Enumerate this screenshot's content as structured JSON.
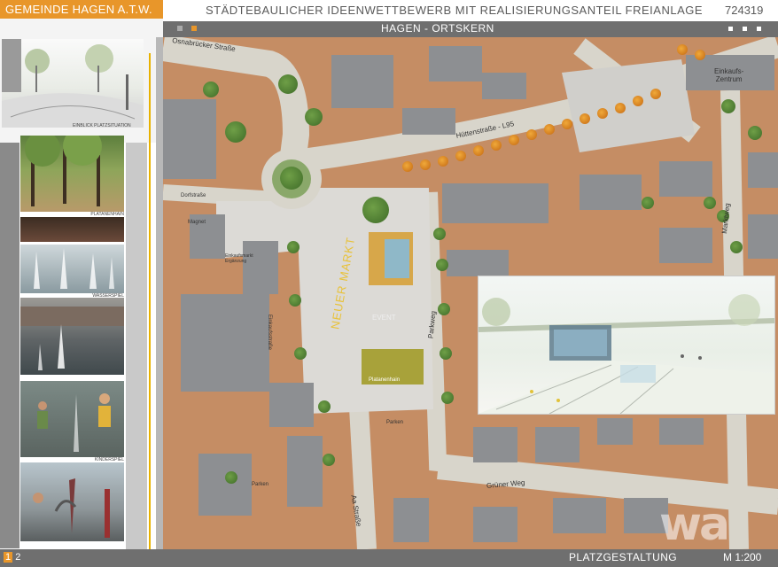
{
  "header": {
    "brand": "GEMEINDE HAGEN A.T.W.",
    "competition_title": "STÄDTEBAULICHER IDEENWETTBEWERB MIT REALISIERUNGSANTEIL FREIANLAGE",
    "competition_id": "724319",
    "subtitle": "HAGEN - ORTSKERN"
  },
  "left_panel": {
    "captions": {
      "sketch": "EINBLICK PLATZSITUATION",
      "trees": "PLATANENHAIN",
      "fountain": "WASSERSPIEL",
      "play": "KINDERSPIEL"
    }
  },
  "map": {
    "streets": {
      "osnabruecker": "Osnabrücker Straße",
      "huetten": "Hüttenstraße - L95",
      "markt": "Marktweg",
      "park": "Parkweg",
      "gruener": "Grüner Weg",
      "aa": "Aa Straße",
      "dorf": "Dorfstraße",
      "einkauf_str": "Einkaufsstraße"
    },
    "labels": {
      "einkaufszentrum": "Einkaufs-\nZentrum",
      "magnet": "Magnet",
      "ergaenzung": "Einkaufsmarkt\nErgänzung",
      "neuer_markt": "NEUER MARKT",
      "event": "EVENT",
      "platanenhain": "Platanenhain",
      "parken": "Parken",
      "parken2": "Parken"
    }
  },
  "footer": {
    "page_1": "1",
    "page_2": "2",
    "title": "PLATZGESTALTUNG",
    "scale": "M 1:200",
    "watermark": "wa"
  },
  "colors": {
    "accent": "#e8962a",
    "bar": "#6f6f6f",
    "ground": "#c58d64"
  }
}
